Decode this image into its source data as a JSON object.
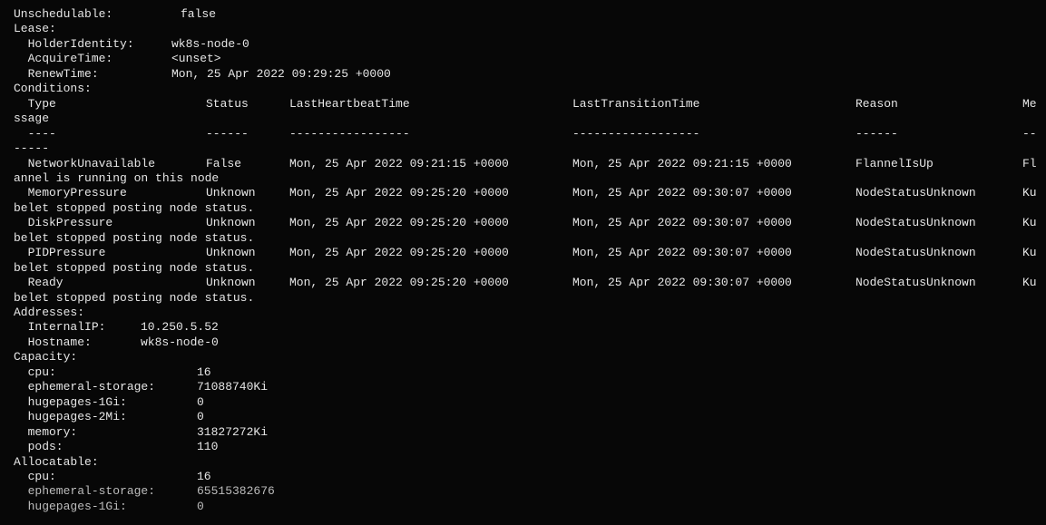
{
  "terminal": {
    "lines": [
      [
        "Unschedulable:      ",
        "false"
      ],
      [
        "Lease:"
      ],
      [
        "  HolderIdentity:  ",
        "wk8s-node-0"
      ],
      [
        "  AcquireTime:     ",
        "<unset>"
      ],
      [
        "  RenewTime:       ",
        "Mon, 25 Apr 2022 09:29:25 +0000"
      ],
      [
        "Conditions:"
      ],
      [
        "  Type",
        "Status",
        "LastHeartbeatTime",
        "LastTransitionTime",
        "Reason",
        "Me"
      ],
      [
        "ssage"
      ],
      [
        "  ----",
        "------",
        "-----------------",
        "------------------",
        "------",
        "--"
      ],
      [
        "-----"
      ],
      [
        "  NetworkUnavailable",
        "False",
        "Mon, 25 Apr 2022 09:21:15 +0000",
        "Mon, 25 Apr 2022 09:21:15 +0000",
        "FlannelIsUp",
        "Fl"
      ],
      [
        "annel is running on this node"
      ],
      [
        "  MemoryPressure",
        "Unknown",
        "Mon, 25 Apr 2022 09:25:20 +0000",
        "Mon, 25 Apr 2022 09:30:07 +0000",
        "NodeStatusUnknown",
        "Ku"
      ],
      [
        "belet stopped posting node status."
      ],
      [
        "  DiskPressure",
        "Unknown",
        "Mon, 25 Apr 2022 09:25:20 +0000",
        "Mon, 25 Apr 2022 09:30:07 +0000",
        "NodeStatusUnknown",
        "Ku"
      ],
      [
        "belet stopped posting node status."
      ],
      [
        "  PIDPressure",
        "Unknown",
        "Mon, 25 Apr 2022 09:25:20 +0000",
        "Mon, 25 Apr 2022 09:30:07 +0000",
        "NodeStatusUnknown",
        "Ku"
      ],
      [
        "belet stopped posting node status."
      ],
      [
        "  Ready",
        "Unknown",
        "Mon, 25 Apr 2022 09:25:20 +0000",
        "Mon, 25 Apr 2022 09:30:07 +0000",
        "NodeStatusUnknown",
        "Ku"
      ],
      [
        "belet stopped posting node status."
      ],
      [
        "Addresses:"
      ],
      [
        "  InternalIP:  ",
        "10.250.5.52"
      ],
      [
        "  Hostname:    ",
        "wk8s-node-0"
      ],
      [
        "Capacity:"
      ],
      [
        "  cpu:                 ",
        "16"
      ],
      [
        "  ephemeral-storage:   ",
        "71088740Ki"
      ],
      [
        "  hugepages-1Gi:       ",
        "0"
      ],
      [
        "  hugepages-2Mi:       ",
        "0"
      ],
      [
        "  memory:              ",
        "31827272Ki"
      ],
      [
        "  pods:                ",
        "110"
      ],
      [
        "Allocatable:"
      ],
      [
        "  cpu:                 ",
        "16"
      ],
      [
        "  ephemeral-storage:   ",
        "65515382676"
      ],
      [
        "  hugepages-1Gi:       ",
        "0"
      ]
    ]
  }
}
